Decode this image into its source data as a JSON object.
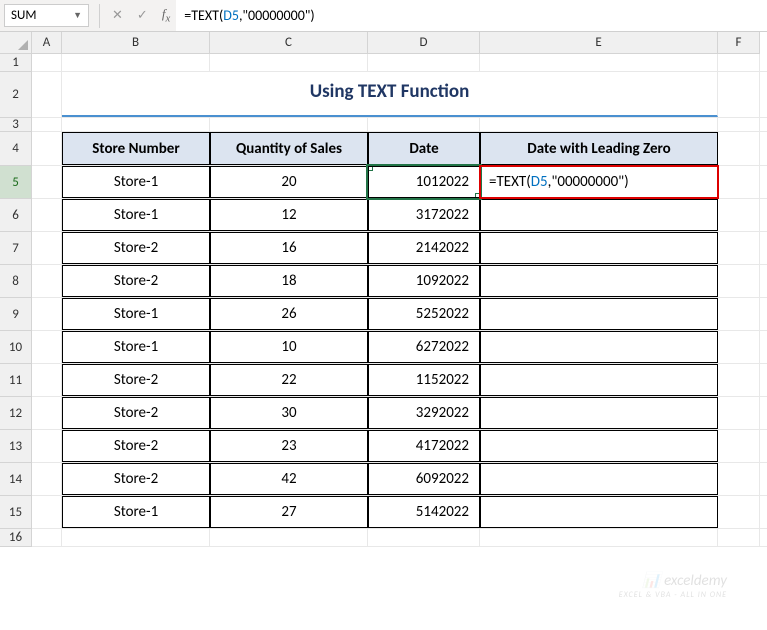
{
  "nameBox": "SUM",
  "formula": {
    "prefix": "=TEXT(",
    "ref": "D5",
    "suffix": ",\"00000000\")"
  },
  "columns": [
    "A",
    "B",
    "C",
    "D",
    "E",
    "F"
  ],
  "rowNumbers": [
    1,
    2,
    3,
    4,
    5,
    6,
    7,
    8,
    9,
    10,
    11,
    12,
    13,
    14,
    15,
    16
  ],
  "title": "Using TEXT Function",
  "headers": {
    "store": "Store Number",
    "qty": "Quantity of Sales",
    "date": "Date",
    "lead": "Date with Leading Zero"
  },
  "rows": [
    {
      "store": "Store-1",
      "qty": "20",
      "date": "1012022",
      "lead_prefix": "=TEXT(",
      "lead_ref": "D5",
      "lead_suffix": ",\"00000000\")"
    },
    {
      "store": "Store-1",
      "qty": "12",
      "date": "3172022"
    },
    {
      "store": "Store-2",
      "qty": "16",
      "date": "2142022"
    },
    {
      "store": "Store-2",
      "qty": "18",
      "date": "1092022"
    },
    {
      "store": "Store-1",
      "qty": "26",
      "date": "5252022"
    },
    {
      "store": "Store-1",
      "qty": "10",
      "date": "6272022"
    },
    {
      "store": "Store-2",
      "qty": "22",
      "date": "1152022"
    },
    {
      "store": "Store-2",
      "qty": "30",
      "date": "3292022"
    },
    {
      "store": "Store-2",
      "qty": "23",
      "date": "4172022"
    },
    {
      "store": "Store-2",
      "qty": "42",
      "date": "6092022"
    },
    {
      "store": "Store-1",
      "qty": "27",
      "date": "5142022"
    }
  ],
  "watermark": {
    "main": "exceldemy",
    "sub": "EXCEL & VBA - ALL IN ONE"
  }
}
